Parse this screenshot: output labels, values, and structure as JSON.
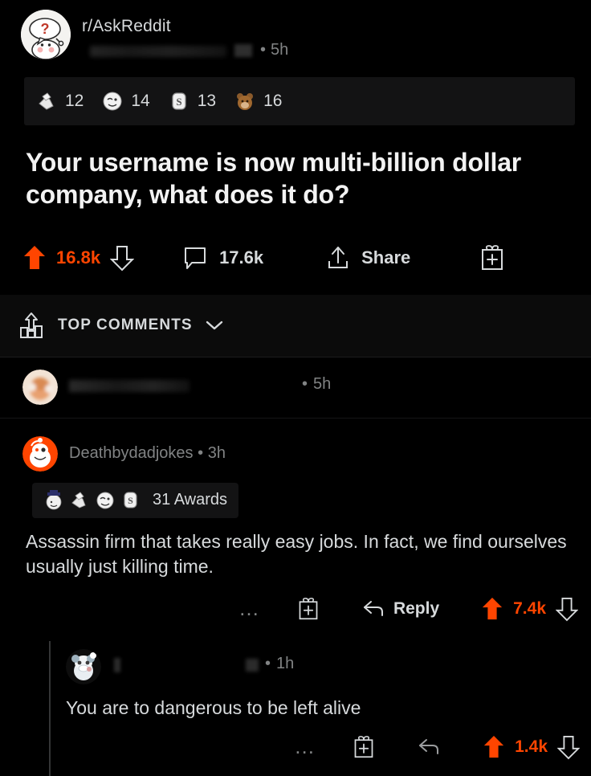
{
  "post": {
    "subreddit": "r/AskReddit",
    "subreddit_icon": "askreddit-question-snoo-icon",
    "author_redacted": true,
    "age": "5h",
    "age_separator": "•",
    "title": "Your username is now multi-billion dollar company, what does it do?",
    "awards": [
      {
        "icon": "silver-hands-award-icon",
        "count": "12"
      },
      {
        "icon": "wholesome-face-award-icon",
        "count": "14"
      },
      {
        "icon": "silver-s-award-icon",
        "count": "13"
      },
      {
        "icon": "bear-hug-award-icon",
        "count": "16"
      }
    ],
    "upvotes": "16.8k",
    "comments": "17.6k",
    "share_label": "Share",
    "icons": {
      "upvote": "upvote-arrow-icon",
      "downvote": "downvote-arrow-icon",
      "comment": "comment-bubble-icon",
      "share": "share-upload-icon",
      "award": "award-gift-icon"
    }
  },
  "sort": {
    "label": "TOP COMMENTS",
    "icon": "sort-top-bar-chart-icon",
    "chevron": "chevron-down-icon"
  },
  "comments": [
    {
      "author_redacted": true,
      "age": "5h",
      "age_separator": "•",
      "avatar": "blurred-orange-avatar"
    },
    {
      "author": "Deathbydadjokes",
      "age": "3h",
      "age_separator": "•",
      "avatar": "orange-snoo-avatar",
      "awards_badge": "31 Awards",
      "awards": [
        {
          "icon": "top-hat-award-icon"
        },
        {
          "icon": "silver-hands-award-icon"
        },
        {
          "icon": "wholesome-face-award-icon"
        },
        {
          "icon": "silver-s-award-icon"
        }
      ],
      "body": "Assassin firm that takes really easy jobs. In fact, we find ourselves usually just killing time.",
      "overflow": "…",
      "reply_label": "Reply",
      "score": "7.4k",
      "icons": {
        "overflow": "more-options-icon",
        "award": "award-gift-icon",
        "reply": "reply-arrow-icon",
        "upvote": "upvote-arrow-icon",
        "downvote": "downvote-arrow-icon"
      },
      "replies": [
        {
          "author_redacted": true,
          "age": "1h",
          "age_separator": "•",
          "avatar": "grey-panda-snoo-avatar",
          "body": "You are to dangerous to be left alive",
          "overflow": "…",
          "score": "1.4k",
          "icons": {
            "overflow": "more-options-icon",
            "award": "award-gift-icon",
            "reply": "reply-arrow-icon",
            "upvote": "upvote-arrow-icon",
            "downvote": "downvote-arrow-icon"
          }
        }
      ]
    }
  ],
  "colors": {
    "background": "#000000",
    "upvote_orange": "#ff4500",
    "text_primary": "#d7dadc",
    "text_secondary": "#818384",
    "surface": "#131314",
    "thread_line": "#343536"
  }
}
